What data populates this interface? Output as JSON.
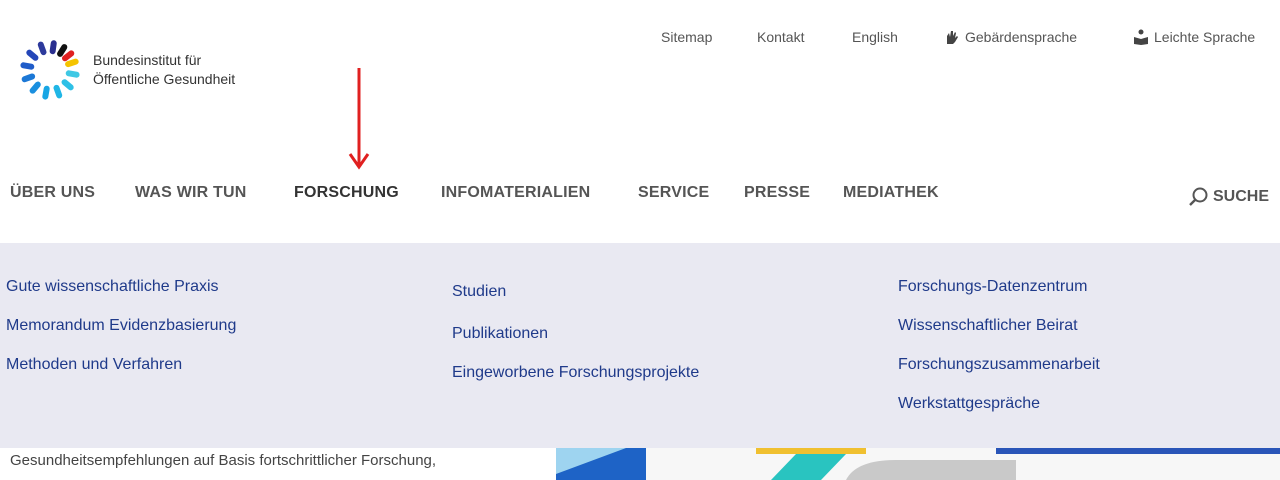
{
  "brand": {
    "line1": "Bundesinstitut für",
    "line2": "Öffentliche Gesundheit"
  },
  "utility_nav": {
    "sitemap": "Sitemap",
    "kontakt": "Kontakt",
    "english": "English",
    "gebaerdensprache": "Gebärdensprache",
    "leichte_sprache": "Leichte Sprache"
  },
  "main_nav": {
    "items": [
      {
        "label": "ÜBER UNS"
      },
      {
        "label": "WAS WIR TUN"
      },
      {
        "label": "FORSCHUNG"
      },
      {
        "label": "INFOMATERIALIEN"
      },
      {
        "label": "SERVICE"
      },
      {
        "label": "PRESSE"
      },
      {
        "label": "MEDIATHEK"
      }
    ],
    "active_index": 2,
    "search_label": "SUCHE"
  },
  "mega_menu": {
    "col1": [
      "Gute wissenschaftliche Praxis",
      "Memorandum Evidenzbasierung",
      "Methoden und Verfahren"
    ],
    "col2": [
      "Studien",
      "Publikationen",
      "Eingeworbene Forschungsprojekte"
    ],
    "col3": [
      "Forschungs-Datenzentrum",
      "Wissenschaftlicher Beirat",
      "Forschungszusammenarbeit",
      "Werkstattgespräche"
    ]
  },
  "page": {
    "intro_text": "Gesundheitsempfehlungen auf Basis fortschrittlicher Forschung,"
  },
  "colors": {
    "accent_blue": "#1f3a8a",
    "menu_bg": "#e9e9f2",
    "annotation_red": "#e02020"
  }
}
